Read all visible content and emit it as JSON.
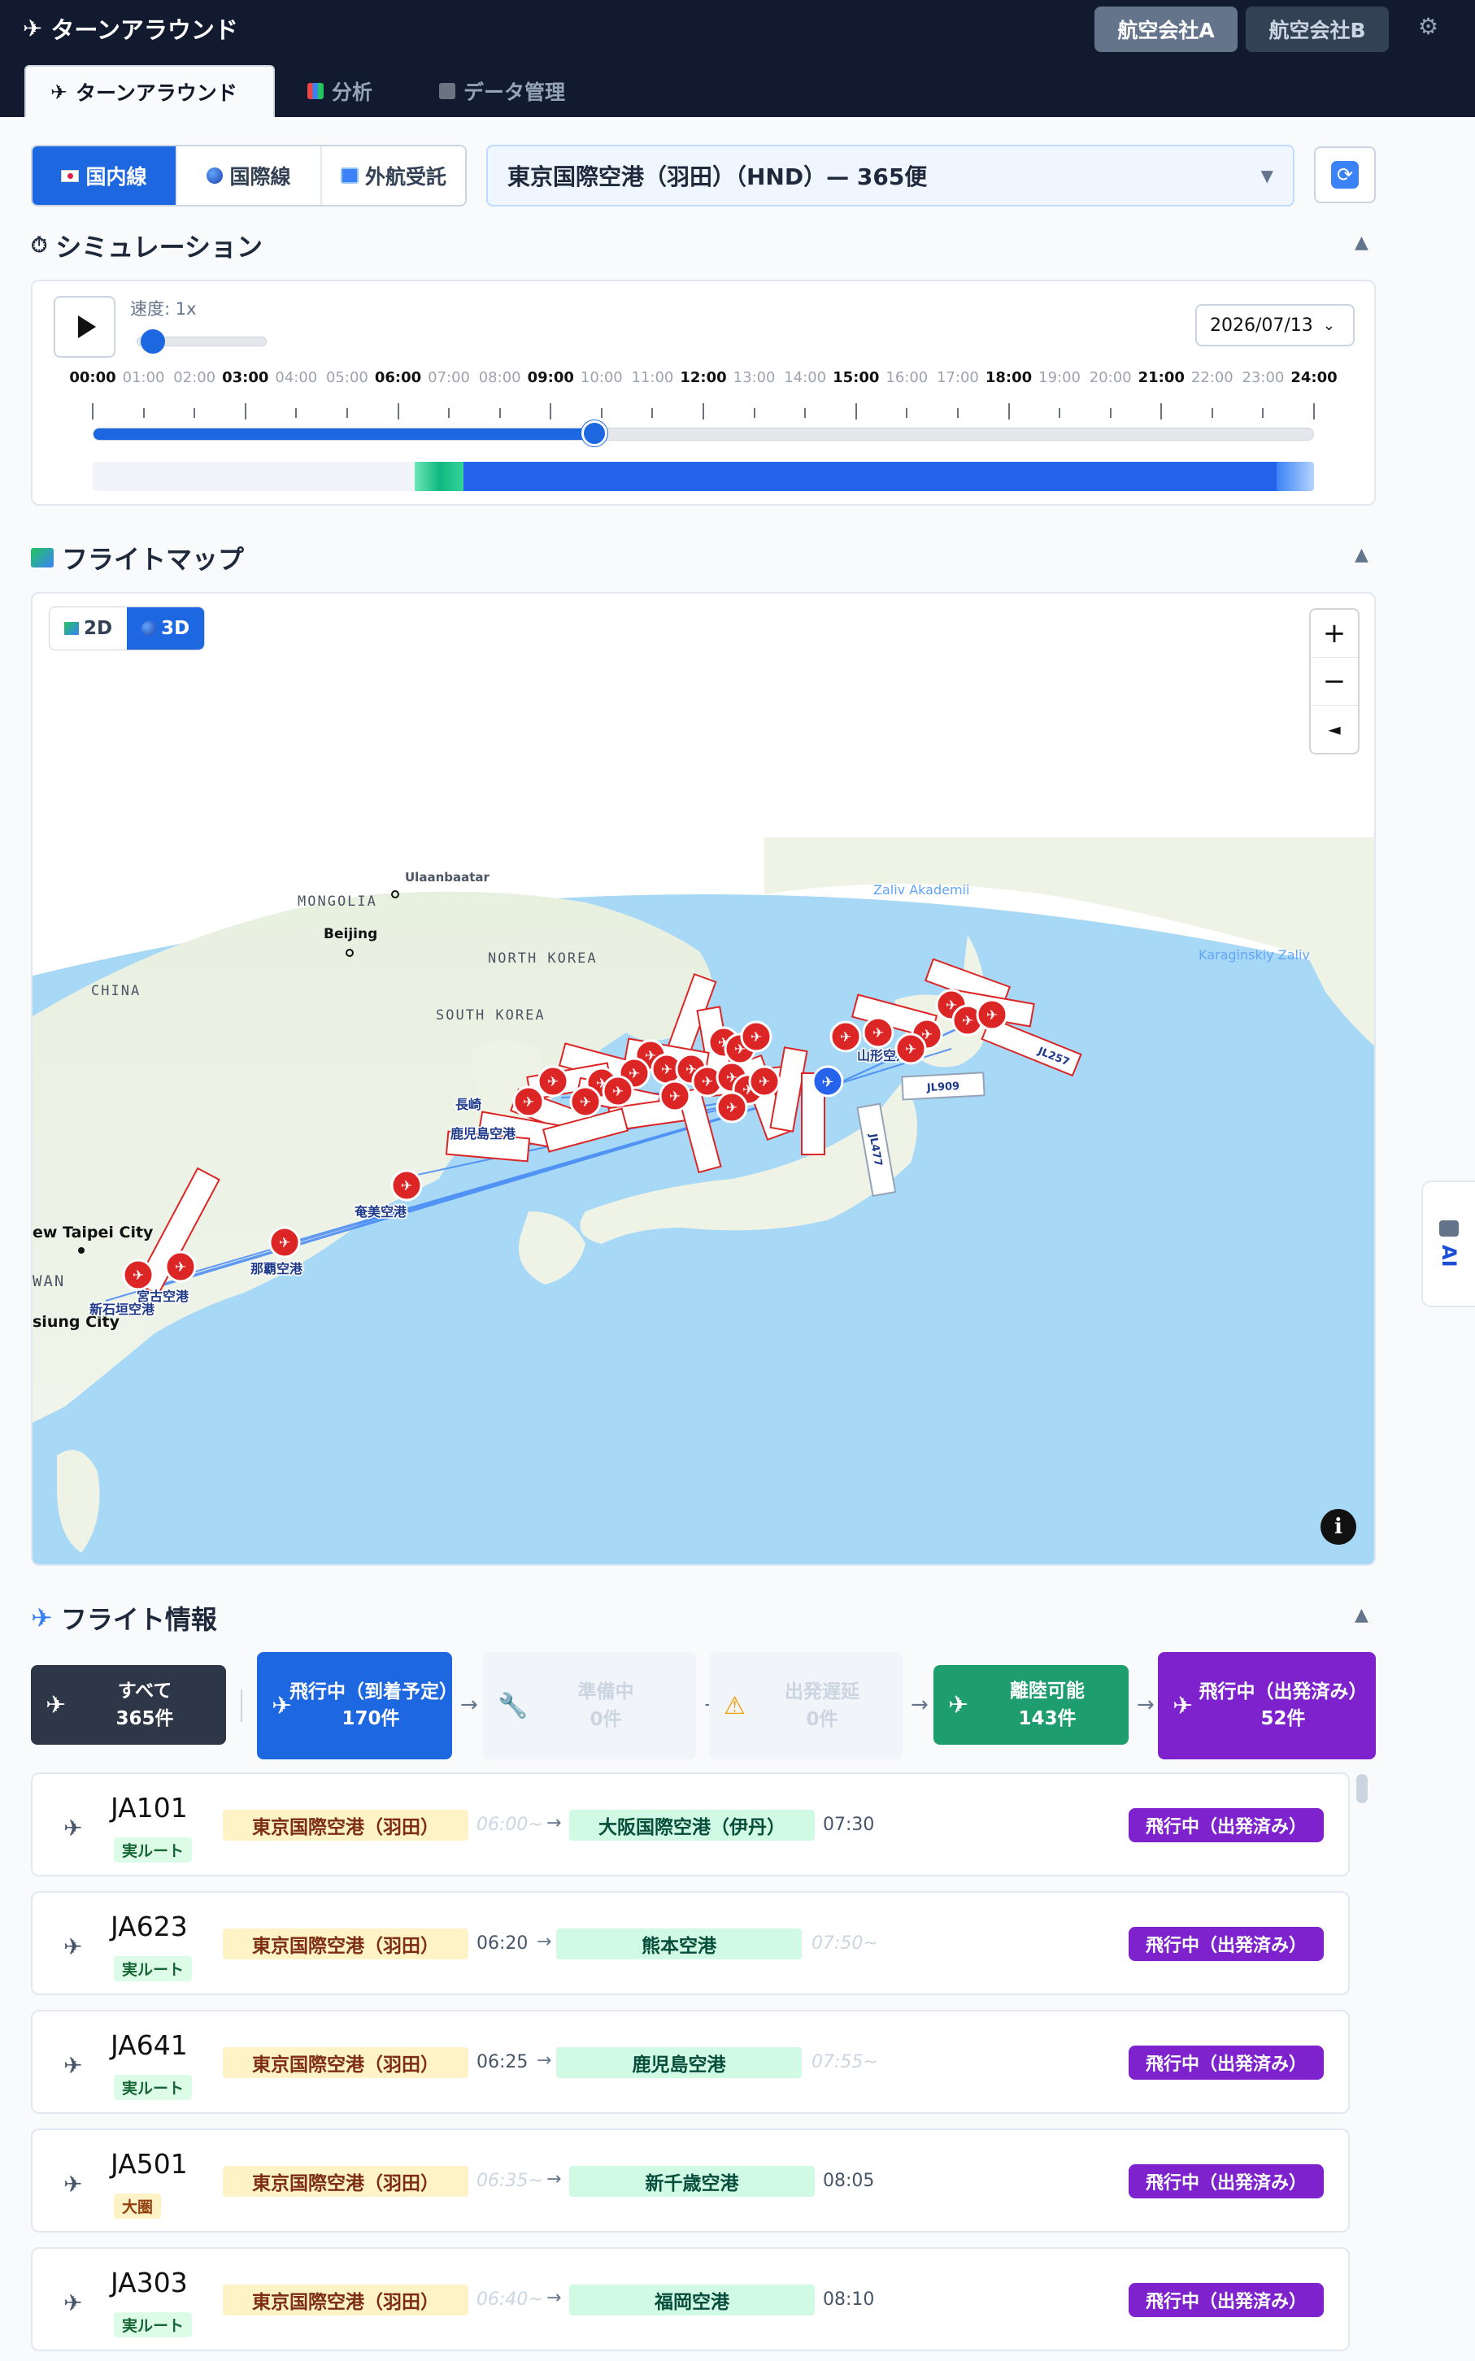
{
  "header": {
    "app_title": "ターンアラウンド",
    "airlines": [
      "航空会社A",
      "航空会社B"
    ],
    "tabs": [
      {
        "label": "ターンアラウンド"
      },
      {
        "label": "分析"
      },
      {
        "label": "データ管理"
      }
    ]
  },
  "controls": {
    "modes": [
      "国内線",
      "国際線",
      "外航受託"
    ],
    "airport_select": "東京国際空港（羽田）（HND）— 365便"
  },
  "simulation": {
    "title": "シミュレーション",
    "speed_label": "速度: 1x",
    "speed_level": 0.05,
    "date": "2026/07/13",
    "hours": [
      "00:00",
      "01:00",
      "02:00",
      "03:00",
      "04:00",
      "05:00",
      "06:00",
      "07:00",
      "08:00",
      "09:00",
      "10:00",
      "11:00",
      "12:00",
      "13:00",
      "14:00",
      "15:00",
      "16:00",
      "17:00",
      "18:00",
      "19:00",
      "20:00",
      "21:00",
      "22:00",
      "23:00",
      "24:00"
    ],
    "progress": 0.41
  },
  "map": {
    "title": "フライトマップ",
    "view_2d": "2D",
    "view_3d": "3D",
    "place_labels": [
      "MONGOLIA",
      "Ulaanbaatar",
      "Beijing",
      "CHINA",
      "NORTH KOREA",
      "SOUTH KOREA",
      "Zaliv Akademii",
      "Karaginskiy Zaliv",
      "ew Taipei City",
      "WAN",
      "siung City"
    ],
    "airport_labels": [
      "奄美空港",
      "那覇空港",
      "宮古空港",
      "新石垣空港",
      "山形空港",
      "長崎",
      "鹿児島空港"
    ],
    "flight_tags": [
      "JL909",
      "JL477",
      "JL257"
    ],
    "zoom_in": "+",
    "zoom_out": "−",
    "compass": "◄",
    "info": "i"
  },
  "flight_info": {
    "title": "フライト情報",
    "cards": [
      {
        "label": "すべて",
        "count": "365件"
      },
      {
        "label": "飛行中（到着予定）",
        "count": "170件"
      },
      {
        "label": "準備中",
        "count": "0件"
      },
      {
        "label": "出発遅延",
        "count": "0件"
      },
      {
        "label": "離陸可能",
        "count": "143件"
      },
      {
        "label": "飛行中（出発済み）",
        "count": "52件"
      }
    ],
    "rows": [
      {
        "reg": "JA101",
        "tag": "実ルート",
        "dep": "東京国際空港（羽田）",
        "dep_time": "06:00~",
        "arr": "大阪国際空港（伊丹）",
        "arr_time": "07:30",
        "status": "飛行中（出発済み）"
      },
      {
        "reg": "JA623",
        "tag": "実ルート",
        "dep": "東京国際空港（羽田）",
        "dep_time": "06:20",
        "arr": "熊本空港",
        "arr_time": "07:50~",
        "status": "飛行中（出発済み）"
      },
      {
        "reg": "JA641",
        "tag": "実ルート",
        "dep": "東京国際空港（羽田）",
        "dep_time": "06:25",
        "arr": "鹿児島空港",
        "arr_time": "07:55~",
        "status": "飛行中（出発済み）"
      },
      {
        "reg": "JA501",
        "tag": "大圏",
        "dep": "東京国際空港（羽田）",
        "dep_time": "06:35~",
        "arr": "新千歳空港",
        "arr_time": "08:05",
        "status": "飛行中（出発済み）"
      },
      {
        "reg": "JA303",
        "tag": "実ルート",
        "dep": "東京国際空港（羽田）",
        "dep_time": "06:40~",
        "arr": "福岡空港",
        "arr_time": "08:10",
        "status": "飛行中（出発済み）"
      }
    ]
  },
  "ai_tab": "AI",
  "colors": {
    "primary": "#1d67e0",
    "departed": "#7e22ce",
    "ready": "#1e9e6e",
    "topbar": "#111a2e",
    "marker": "#dc2626"
  }
}
